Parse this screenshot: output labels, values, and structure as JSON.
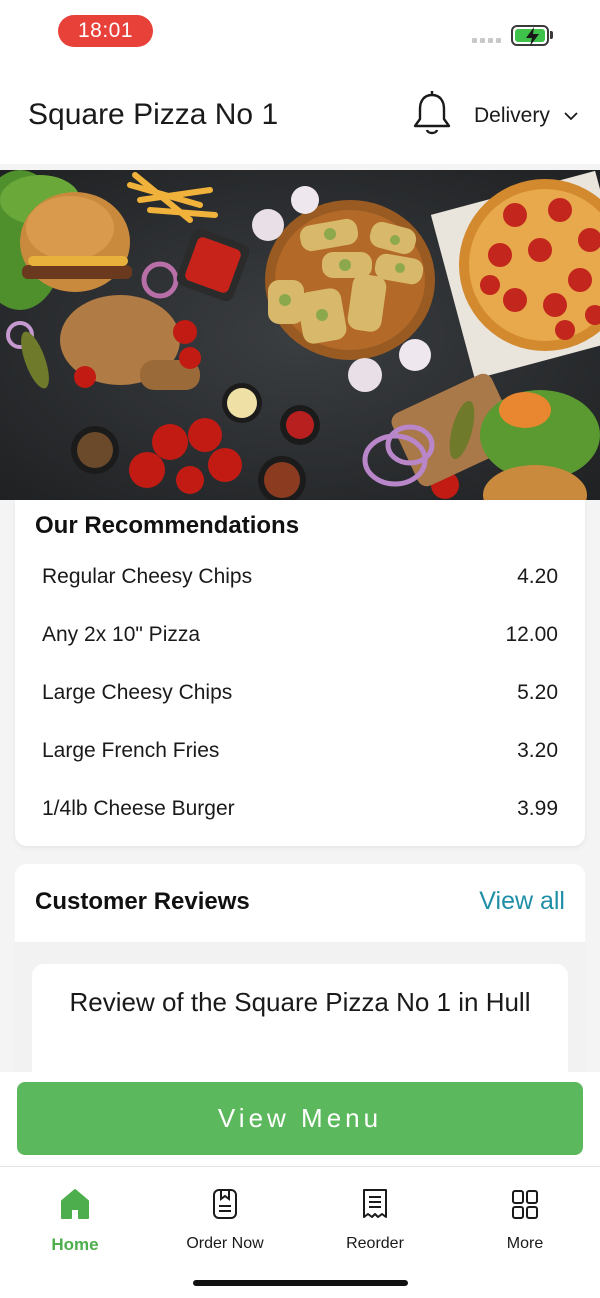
{
  "status_bar": {
    "time": "18:01"
  },
  "header": {
    "title": "Square Pizza No 1",
    "delivery_label": "Delivery"
  },
  "recommendations": {
    "title": "Our Recommendations",
    "items": [
      {
        "name": "Regular Cheesy Chips",
        "price": "4.20"
      },
      {
        "name": "Any 2x 10\" Pizza",
        "price": "12.00"
      },
      {
        "name": "Large Cheesy Chips",
        "price": "5.20"
      },
      {
        "name": "Large French Fries",
        "price": "3.20"
      },
      {
        "name": "1/4lb Cheese Burger",
        "price": "3.99"
      }
    ]
  },
  "reviews": {
    "title": "Customer Reviews",
    "view_all_label": "View all",
    "review_heading": "Review of the Square Pizza No 1 in Hull"
  },
  "view_menu_label": "View Menu",
  "tabs": [
    {
      "label": "Home",
      "icon": "home-icon",
      "active": true
    },
    {
      "label": "Order Now",
      "icon": "order-icon",
      "active": false
    },
    {
      "label": "Reorder",
      "icon": "receipt-icon",
      "active": false
    },
    {
      "label": "More",
      "icon": "grid-icon",
      "active": false
    }
  ],
  "colors": {
    "accent_green": "#5cb85c",
    "link_blue": "#1f8fa8",
    "time_pill": "#e8413a"
  }
}
